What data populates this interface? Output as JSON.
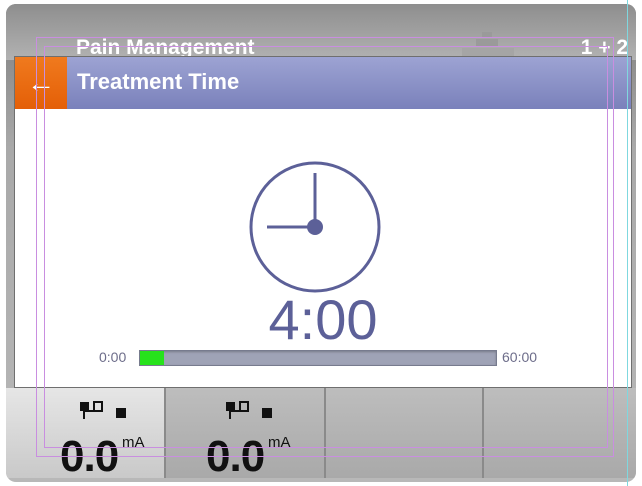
{
  "background_screen": {
    "title": "Pain Management",
    "channel_indicator": "1 + 2",
    "icon": "body-area-icon"
  },
  "dialog": {
    "title": "Treatment Time",
    "back_icon": "←",
    "time_display": "4:00",
    "range_min": "0:00",
    "range_max": "60:00",
    "progress_fraction": 0.067,
    "clock_icon": "clock-icon",
    "progress_color": "#27e21b"
  },
  "channels": [
    {
      "value": "0.0",
      "unit": "mA",
      "icon": "electrode-pair-icon",
      "state_icon": "stopped-square-icon",
      "active": true
    },
    {
      "value": "0.0",
      "unit": "mA",
      "icon": "electrode-pair-icon",
      "state_icon": "stopped-square-icon",
      "active": false
    },
    {
      "value": "",
      "unit": "",
      "active": false
    },
    {
      "value": "",
      "unit": "",
      "active": false
    }
  ],
  "colors": {
    "header_gradient_top": "#9da3d3",
    "header_gradient_bottom": "#7a81bb",
    "back_button": "#e45f07",
    "text_time": "#5c6098"
  }
}
